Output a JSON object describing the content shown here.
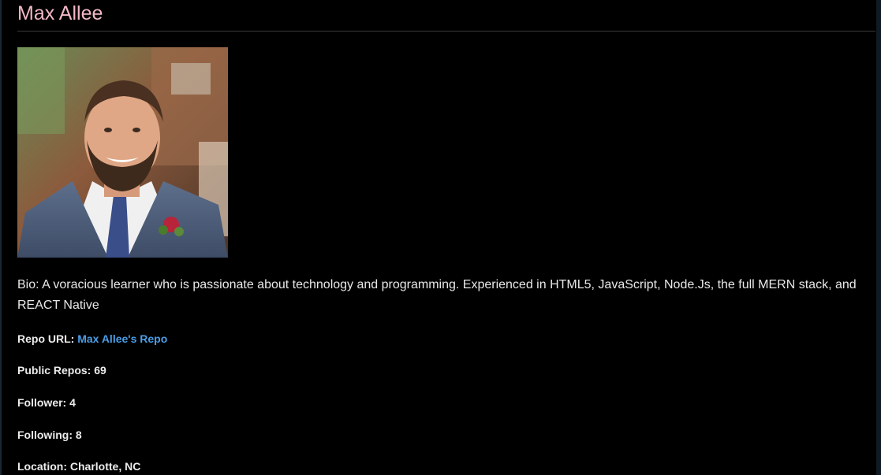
{
  "profile": {
    "name": "Max Allee",
    "bio": "Bio: A voracious learner who is passionate about technology and programming. Experienced in HTML5, JavaScript, Node.Js, the full MERN stack, and REACT Native",
    "repo_label": "Repo URL:",
    "repo_link_text": "Max Allee's Repo",
    "public_repos": "Public Repos: 69",
    "followers": "Follower: 4",
    "following": "Following: 8",
    "location": "Location: Charlotte, NC"
  },
  "colors": {
    "background": "#000000",
    "name": "#f2b8c6",
    "link": "#4b9ee8",
    "text": "#e6e6e6"
  }
}
